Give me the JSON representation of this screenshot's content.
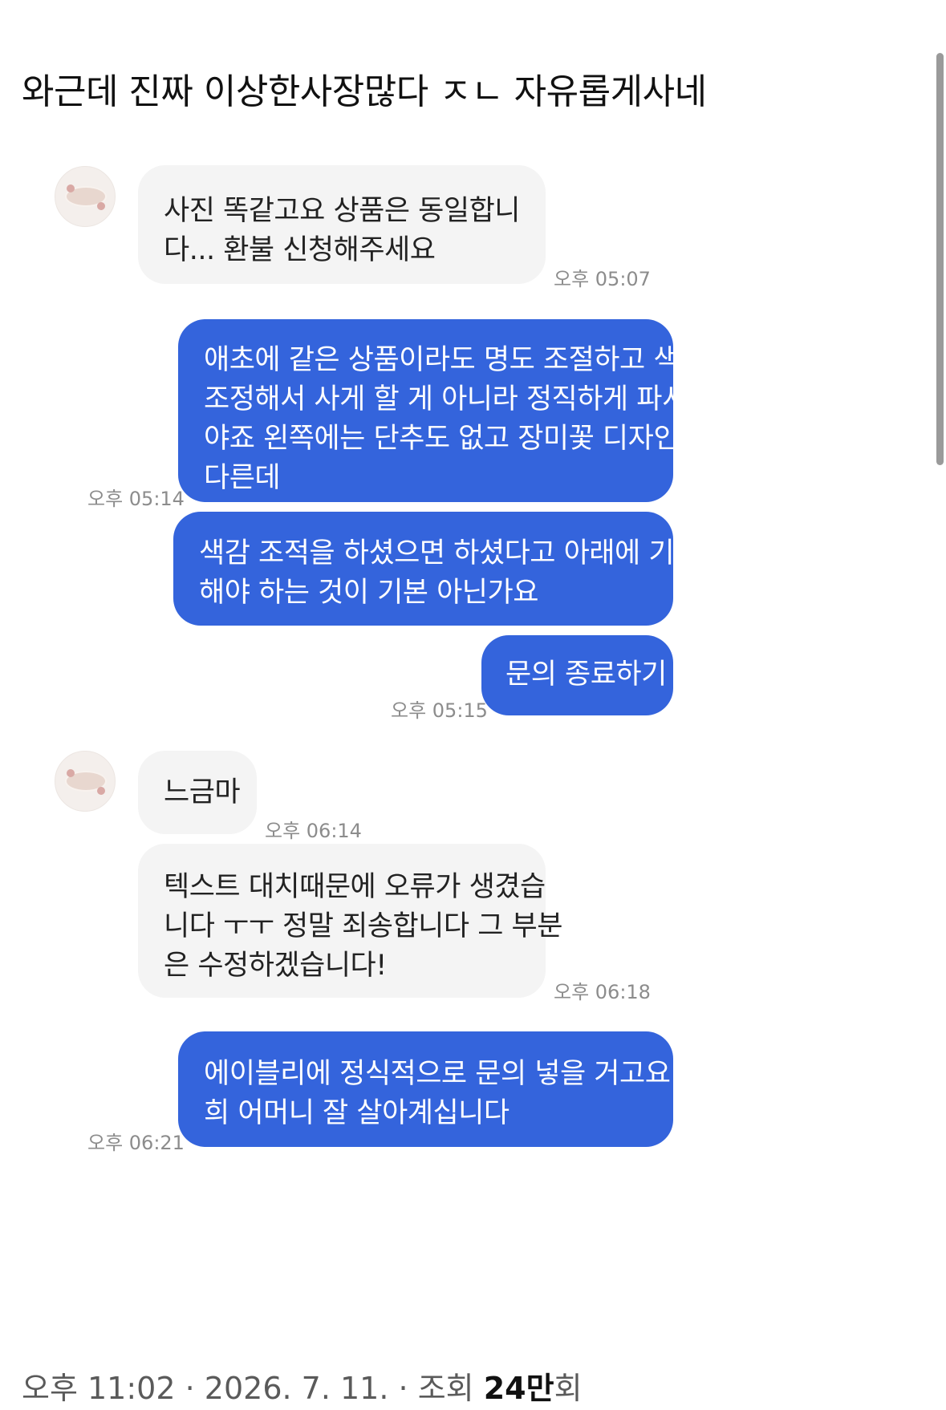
{
  "post": {
    "text": "와근데 진짜 이상한사장많다 ㅈㄴ 자유롭게사네"
  },
  "chat": {
    "messages": [
      {
        "side": "in",
        "lines": [
          "사진 똑같고요 상품은 동일합니",
          "다... 환불 신청해주세요"
        ],
        "time": "오후 05:07"
      },
      {
        "side": "out",
        "lines": [
          "애초에 같은 상품이라도 명도 조절하고 색감",
          "조정해서 사게 할 게 아니라 정직하게 파셔",
          "야죠 왼쪽에는 단추도 없고 장미꽃 디자인도",
          "다른데"
        ],
        "time": "오후 05:14"
      },
      {
        "side": "out",
        "lines": [
          "색감 조적을 하셨으면 하셨다고 아래에 기재",
          "해야 하는 것이 기본 아닌가요"
        ]
      },
      {
        "side": "out",
        "lines": [
          "문의 종료하기"
        ],
        "time": "오후 05:15"
      },
      {
        "side": "in",
        "lines": [
          "느금마"
        ],
        "time": "오후 06:14"
      },
      {
        "side": "in",
        "lines": [
          "텍스트 대치때문에 오류가 생겼습",
          "니다 ㅜㅜ 정말 죄송합니다 그 부분",
          "은 수정하겠습니다!"
        ],
        "time": "오후 06:18"
      },
      {
        "side": "out",
        "lines": [
          "에이블리에 정식적으로 문의 넣을 거고요 저",
          "희 어머니 잘 살아계십니다"
        ],
        "time": "오후 06:21"
      }
    ]
  },
  "footer": {
    "time": "오후 11:02",
    "separator": "·",
    "date": "2026. 7. 11.",
    "views_label": "조회",
    "views_count": "24만",
    "views_suffix": "회"
  },
  "colors": {
    "outgoing_bubble": "#3464dc",
    "incoming_bubble": "#f4f4f4"
  },
  "icons": [
    "shop-avatar-icon"
  ]
}
